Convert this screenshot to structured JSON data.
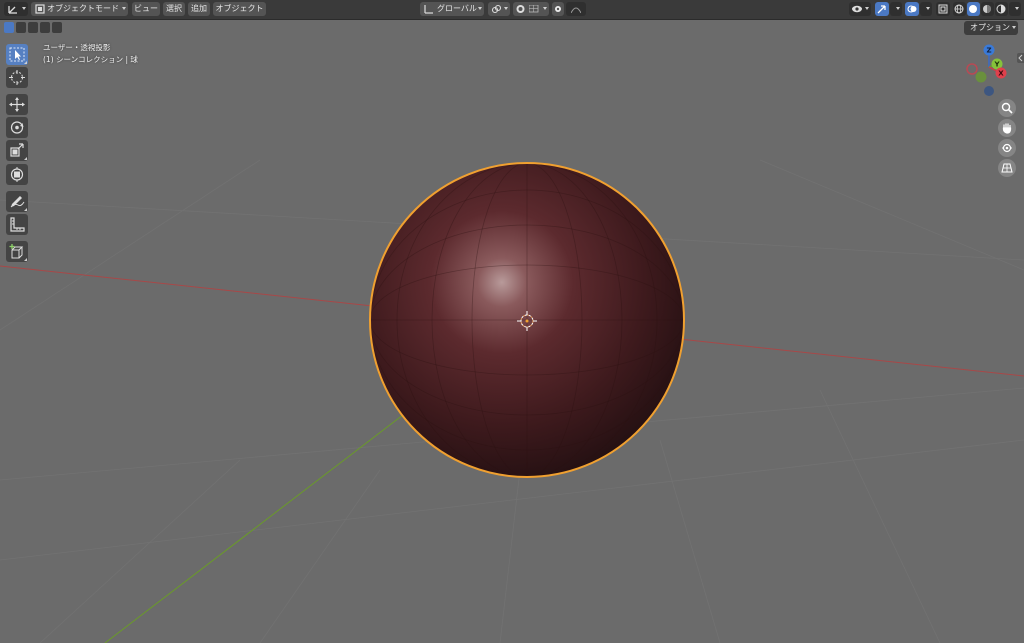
{
  "header": {
    "editor_type_icon": "3d-viewport-icon",
    "mode": {
      "icon": "object-mode-icon",
      "label": "オブジェクトモード"
    },
    "menus": [
      "ビュー",
      "選択",
      "追加",
      "オブジェクト"
    ],
    "transform_orientation": {
      "icon": "orientation-axes-icon",
      "label": "グローバル"
    },
    "pivot_icon": "link-icon",
    "snap_icon": "snap-magnet-icon",
    "proportional_icon": "proportional-edit-icon",
    "right": {
      "visibility_icon": "eye-icon",
      "gizmo_icon": "gizmo-arrow-icon",
      "overlay_icon": "overlay-circles-icon",
      "xray_icon": "xray-icon",
      "shading_modes": [
        "wireframe-icon",
        "solid-shading-icon",
        "material-preview-icon",
        "rendered-icon"
      ]
    }
  },
  "select_modes": [
    "select-new-icon",
    "select-extend-icon",
    "select-subtract-icon",
    "select-difference-icon",
    "select-intersect-icon"
  ],
  "options_button": "オプション",
  "viewport_overlay": {
    "view_name": "ユーザー・透視投影",
    "collection": "(1) シーンコレクション | 球"
  },
  "toolbar": [
    {
      "name": "select-tool",
      "icon": "cursor-arrow-icon",
      "active": true
    },
    {
      "name": "cursor-tool",
      "icon": "3d-cursor-icon",
      "active": false
    },
    {
      "name": "move-tool",
      "icon": "move-arrows-icon",
      "active": false
    },
    {
      "name": "rotate-tool",
      "icon": "rotate-icon",
      "active": false
    },
    {
      "name": "scale-tool",
      "icon": "scale-icon",
      "active": false
    },
    {
      "name": "transform-tool",
      "icon": "transform-icon",
      "active": false
    },
    {
      "name": "annotate-tool",
      "icon": "pencil-icon",
      "active": false
    },
    {
      "name": "measure-tool",
      "icon": "ruler-icon",
      "active": false
    },
    {
      "name": "add-cube-tool",
      "icon": "add-cube-icon",
      "active": false
    }
  ],
  "nav_gizmo": {
    "x": "X",
    "y": "Y",
    "z": "Z"
  },
  "nav_buttons": [
    "zoom-icon",
    "hand-pan-icon",
    "camera-view-icon",
    "grid-perspective-icon"
  ],
  "colors": {
    "viewport_bg": "#6b6b6b",
    "header_bg": "#3a3a3a",
    "sphere_base": "#4a1e22",
    "sphere_outline": "#f0a030",
    "x_axis": "#a84848",
    "y_axis": "#6a9a2a",
    "accent_blue": "#4b79c4"
  }
}
